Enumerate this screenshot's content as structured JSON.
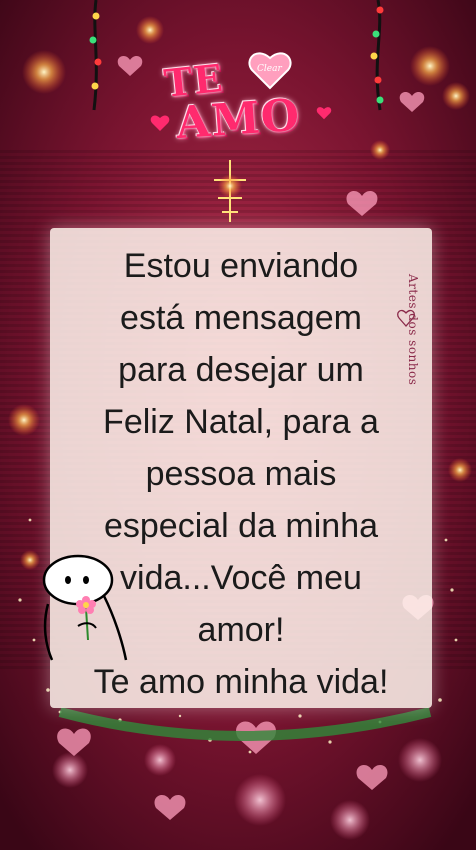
{
  "logo": {
    "line1": "TE",
    "line2": "AMO",
    "badge": "Clear"
  },
  "watermark": "Artes dos sonhos",
  "message": {
    "text": "Estou enviando\nestá mensagem\npara desejar um\nFeliz Natal, para a\npessoa mais\nespecial da minha\nvida...Você meu\namor!\nTe amo minha vida!"
  },
  "colors": {
    "background": "#5a0a22",
    "accent_pink": "#ff2a6e",
    "card": "#fff5ee",
    "text": "#1b1b1b"
  }
}
